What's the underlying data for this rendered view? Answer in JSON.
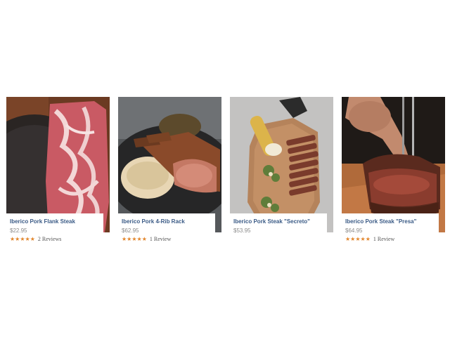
{
  "products": [
    {
      "name": "Iberico Pork Flank Steak",
      "price": "$22.95",
      "stars": "★★★★★",
      "reviews": "2 Reviews",
      "rating": 5
    },
    {
      "name": "Iberico Pork 4-Rib Rack",
      "price": "$62.95",
      "stars": "★★★★★",
      "reviews": "1 Review",
      "rating": 5
    },
    {
      "name": "Iberico Pork Steak \"Secreto\"",
      "price": "$53.95"
    },
    {
      "name": "Iberico Pork Steak \"Presa\"",
      "price": "$64.95",
      "stars": "★★★★★",
      "reviews": "1 Review",
      "rating": 5
    }
  ],
  "colors": {
    "title": "#3b5b86",
    "star": "#e2862c",
    "price": "#8b8b8b"
  }
}
